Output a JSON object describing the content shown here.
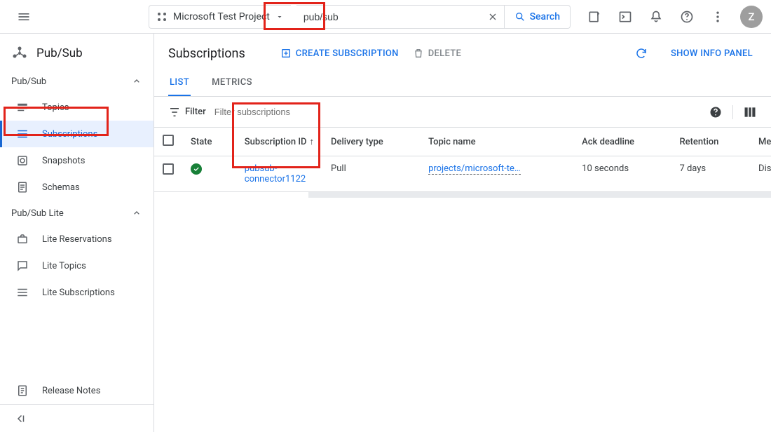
{
  "header": {
    "project_name": "Microsoft Test Project",
    "search_value": "pub/sub",
    "search_button": "Search",
    "avatar_initial": "Z"
  },
  "sidebar": {
    "product_title": "Pub/Sub",
    "section1": "Pub/Sub",
    "items1": {
      "topics": "Topics",
      "subscriptions": "Subscriptions",
      "snapshots": "Snapshots",
      "schemas": "Schemas"
    },
    "section2": "Pub/Sub Lite",
    "items2": {
      "lite_reservations": "Lite Reservations",
      "lite_topics": "Lite Topics",
      "lite_subscriptions": "Lite Subscriptions"
    },
    "release_notes": "Release Notes"
  },
  "main": {
    "title": "Subscriptions",
    "create": "CREATE SUBSCRIPTION",
    "delete": "DELETE",
    "show_info": "SHOW INFO PANEL",
    "tabs": {
      "list": "LIST",
      "metrics": "METRICS"
    },
    "filter_label": "Filter",
    "filter_placeholder": "Filter subscriptions"
  },
  "table": {
    "headers": {
      "state": "State",
      "subscription_id": "Subscription ID",
      "delivery_type": "Delivery type",
      "topic_name": "Topic name",
      "ack_deadline": "Ack deadline",
      "retention": "Retention",
      "message_ordering": "Message orde"
    },
    "row": {
      "subscription_id": "pubsub-connector1122",
      "delivery_type": "Pull",
      "topic_name": "projects/microsoft-te…",
      "ack_deadline": "10 seconds",
      "retention": "7 days",
      "message_ordering": "Disabled"
    }
  }
}
